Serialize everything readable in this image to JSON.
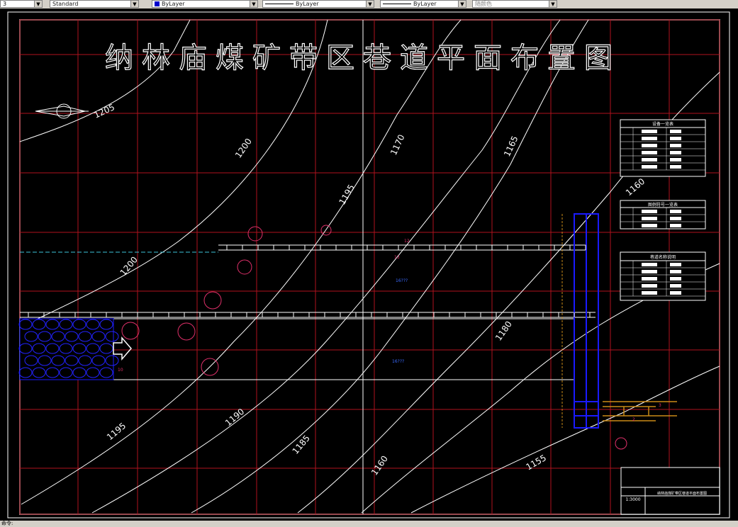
{
  "toolbar": {
    "text_style": "Standard",
    "color": "ByLayer",
    "linetype": "ByLayer",
    "lineweight": "ByLayer",
    "plot_style": "随颜色",
    "layer_partial": "3"
  },
  "drawing": {
    "title": "纳林庙煤矿带区巷道平面布置图",
    "contours": [
      "1205",
      "1200",
      "1195",
      "1170",
      "1165",
      "1160",
      "1200",
      "1195",
      "1190",
      "1185",
      "1180",
      "1160",
      "1155"
    ],
    "labels": {
      "workface_upper": "16???",
      "workface_lower": "16???",
      "n12": "12",
      "n13": "13",
      "n10": "10",
      "n3": "3",
      "n2": "2"
    },
    "tables": {
      "legend1": "设备一览表",
      "legend2": "图例符号一览表",
      "legend3": "巷道名称说明",
      "title_block_scale": "1:3000",
      "title_block_name": "纳林庙煤矿带区巷道平面布置图"
    }
  },
  "status": {
    "text": "命令:"
  }
}
